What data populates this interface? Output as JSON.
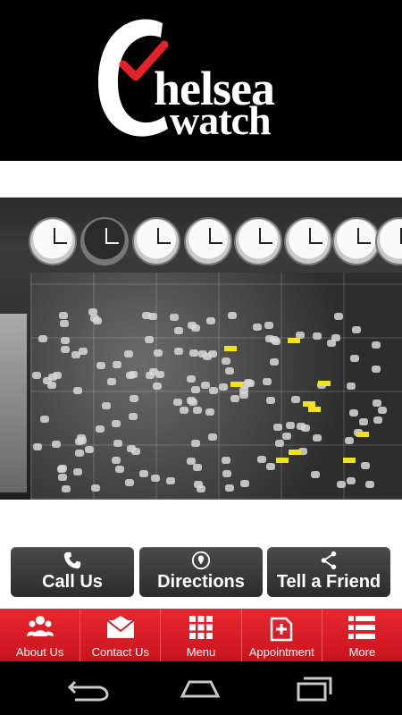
{
  "header": {
    "logo_line1": "helsea",
    "logo_line2": "watch",
    "check_color": "#e32229"
  },
  "photo": {
    "icon": "store-photo"
  },
  "actions": [
    {
      "label": "Call Us",
      "icon": "phone-icon"
    },
    {
      "label": "Directions",
      "icon": "location-pin-icon"
    },
    {
      "label": "Tell a Friend",
      "icon": "share-icon"
    }
  ],
  "tabs": [
    {
      "label": "About Us",
      "icon": "people-icon"
    },
    {
      "label": "Contact Us",
      "icon": "envelope-icon"
    },
    {
      "label": "Menu",
      "icon": "grid-icon"
    },
    {
      "label": "Appointment",
      "icon": "calendar-add-icon"
    },
    {
      "label": "More",
      "icon": "list-icon"
    }
  ],
  "colors": {
    "tabbar": "#e32229",
    "button": "#3a3a3a"
  }
}
